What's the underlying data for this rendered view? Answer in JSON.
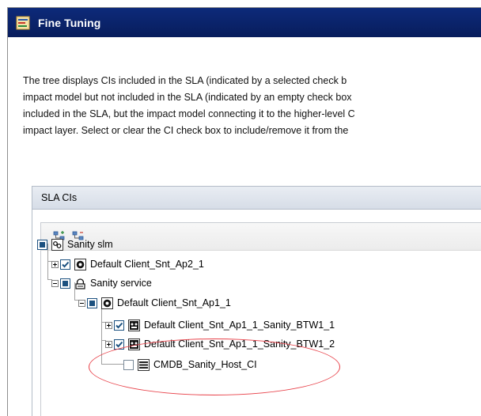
{
  "window": {
    "title": "Fine Tuning"
  },
  "description": {
    "lines": [
      "The tree displays CIs included in the SLA (indicated by a selected check b",
      "impact model but not included in the SLA (indicated by an empty check box",
      "included in the SLA, but the impact model connecting it to the higher-level C",
      "impact layer. Select or clear the CI check box to include/remove it from the"
    ]
  },
  "panel": {
    "title": "SLA CIs"
  },
  "toolbar": {
    "buttons": [
      "expand-all-icon",
      "collapse-all-icon"
    ]
  },
  "tree": {
    "nodes": [
      {
        "label": "Sanity slm",
        "check": "partial",
        "icon": "business-process-icon"
      },
      {
        "label": "Default Client_Snt_Ap2_1",
        "check": "checked",
        "icon": "monitor-icon",
        "expander": "plus"
      },
      {
        "label": "Sanity service",
        "check": "partial",
        "icon": "service-icon",
        "expander": "minus"
      },
      {
        "label": "Default Client_Snt_Ap1_1",
        "check": "partial",
        "icon": "monitor-icon",
        "expander": "minus"
      },
      {
        "label": "Default Client_Snt_Ap1_1_Sanity_BTW1_1",
        "check": "checked",
        "icon": "transaction-icon",
        "expander": "plus"
      },
      {
        "label": "Default Client_Snt_Ap1_1_Sanity_BTW1_2",
        "check": "checked",
        "icon": "transaction-icon",
        "expander": "plus"
      },
      {
        "label": "CMDB_Sanity_Host_CI",
        "check": "empty",
        "icon": "host-icon"
      }
    ]
  },
  "highlight_color": "#e8424a"
}
